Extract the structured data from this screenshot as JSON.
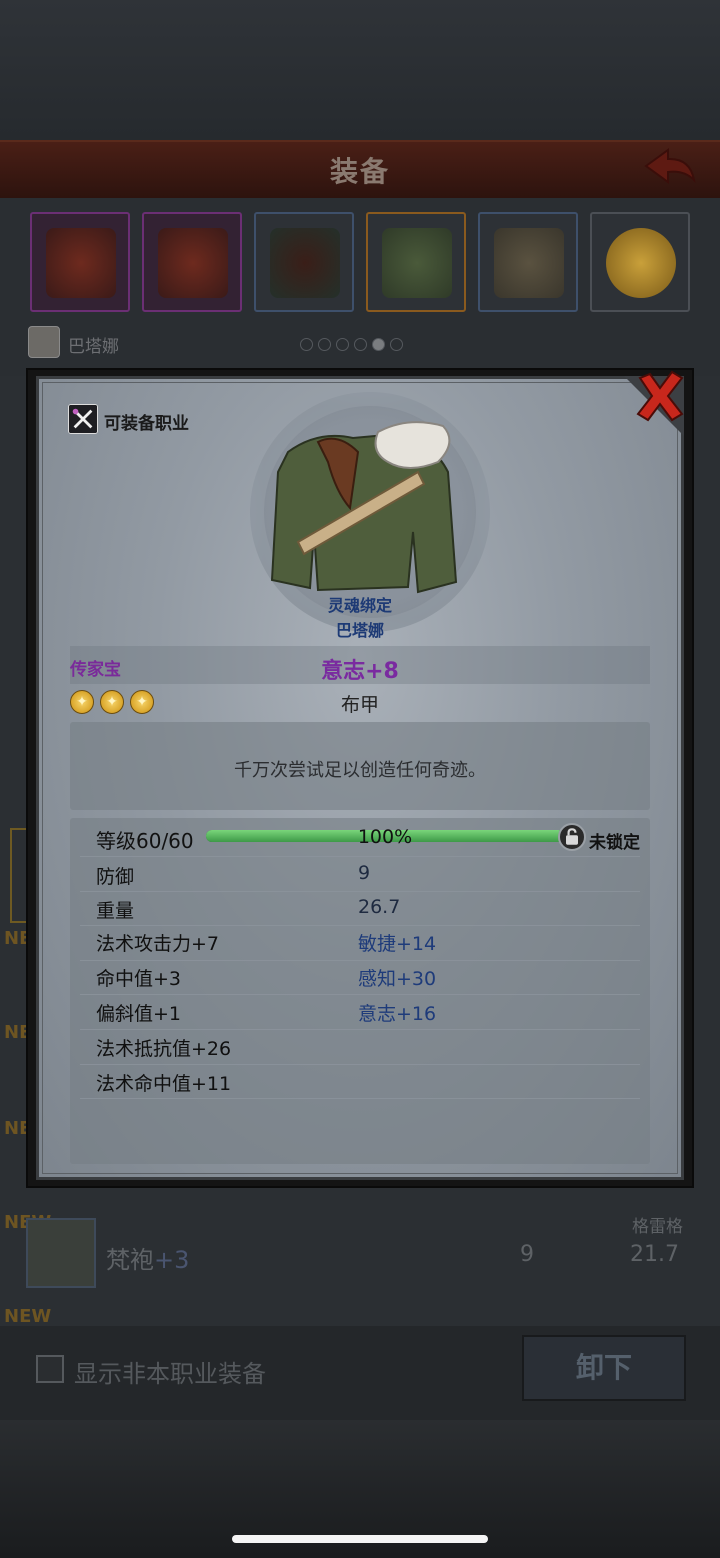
{
  "screen": {
    "title": "装备",
    "character_name": "巴塔娜",
    "page_dots_total": 6,
    "page_dots_active": 4,
    "list_row": {
      "new_label": "NEW",
      "name": "梵袍",
      "name_suffix": "+3",
      "defense": "9",
      "weight": "21.7",
      "owner": "格雷格"
    },
    "show_other_class_label": "显示非本职业装备",
    "unequip_label": "卸下"
  },
  "modal": {
    "equip_class_label": "可装备职业",
    "bind_status": "灵魂绑定",
    "bound_to": "巴塔娜",
    "rarity": "传家宝",
    "main_bonus": "意志+8",
    "stars": 3,
    "armor_type": "布甲",
    "description": "千万次尝试足以创造任何奇迹。",
    "level_label": "等级60/60",
    "xp_percent_text": "100%",
    "xp_fraction": 1.0,
    "lock_label": "未锁定",
    "stats": {
      "defense_label": "防御",
      "defense_value": "9",
      "weight_label": "重量",
      "weight_value": "26.7",
      "spell_attack": "法术攻击力+7",
      "agility": "敏捷+14",
      "hit": "命中值+3",
      "perception": "感知+30",
      "deflect": "偏斜值+1",
      "will": "意志+16",
      "spell_resist": "法术抵抗值+26",
      "spell_hit": "法术命中值+11"
    }
  },
  "colors": {
    "rarity": "#7a2a9a",
    "bonus_blue": "#1e3b7a",
    "xp_green": "#4cb458",
    "header_red": "#4a1f16"
  }
}
